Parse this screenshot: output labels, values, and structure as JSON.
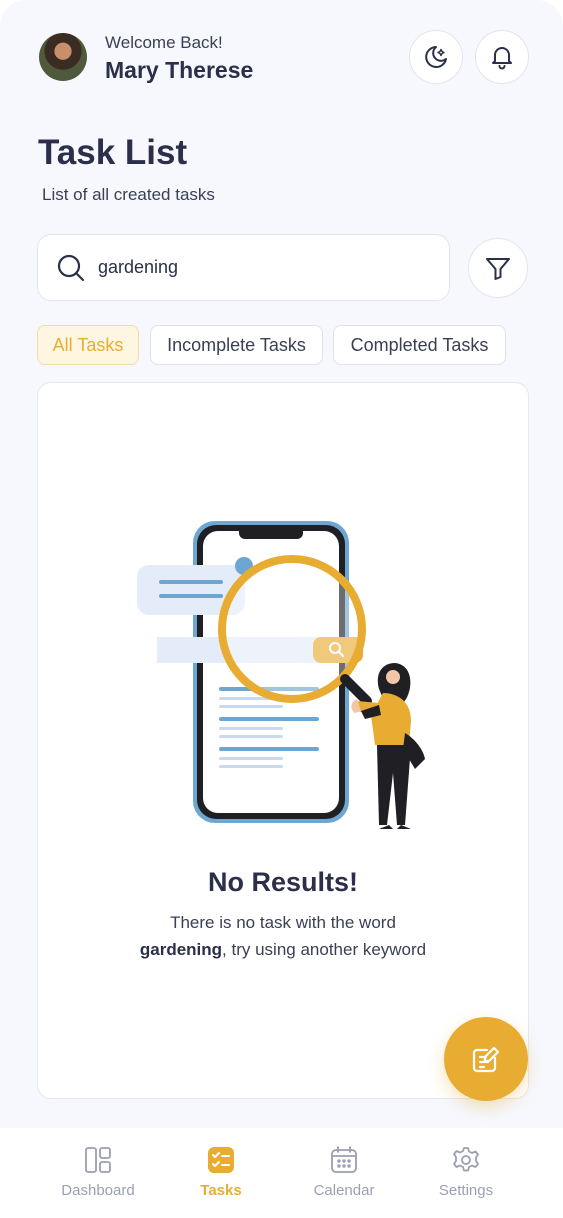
{
  "header": {
    "greeting": "Welcome Back!",
    "user_name": "Mary Therese"
  },
  "page": {
    "title": "Task List",
    "subtitle": "List of all created tasks"
  },
  "search": {
    "value": "gardening"
  },
  "tabs": [
    {
      "label": "All Tasks",
      "active": true
    },
    {
      "label": "Incomplete Tasks",
      "active": false
    },
    {
      "label": "Completed Tasks",
      "active": false
    }
  ],
  "empty_state": {
    "heading": "No Results!",
    "line1": "There is no task with the word",
    "keyword": "gardening",
    "line2_rest": ", try using another keyword"
  },
  "nav": [
    {
      "label": "Dashboard",
      "icon": "dashboard-icon",
      "active": false
    },
    {
      "label": "Tasks",
      "icon": "tasks-icon",
      "active": true
    },
    {
      "label": "Calendar",
      "icon": "calendar-icon",
      "active": false
    },
    {
      "label": "Settings",
      "icon": "gear-icon",
      "active": false
    }
  ],
  "colors": {
    "accent": "#e8ac33",
    "text_dark": "#2b2f4a",
    "muted": "#9b9fb3",
    "background": "#f6f8fd"
  }
}
